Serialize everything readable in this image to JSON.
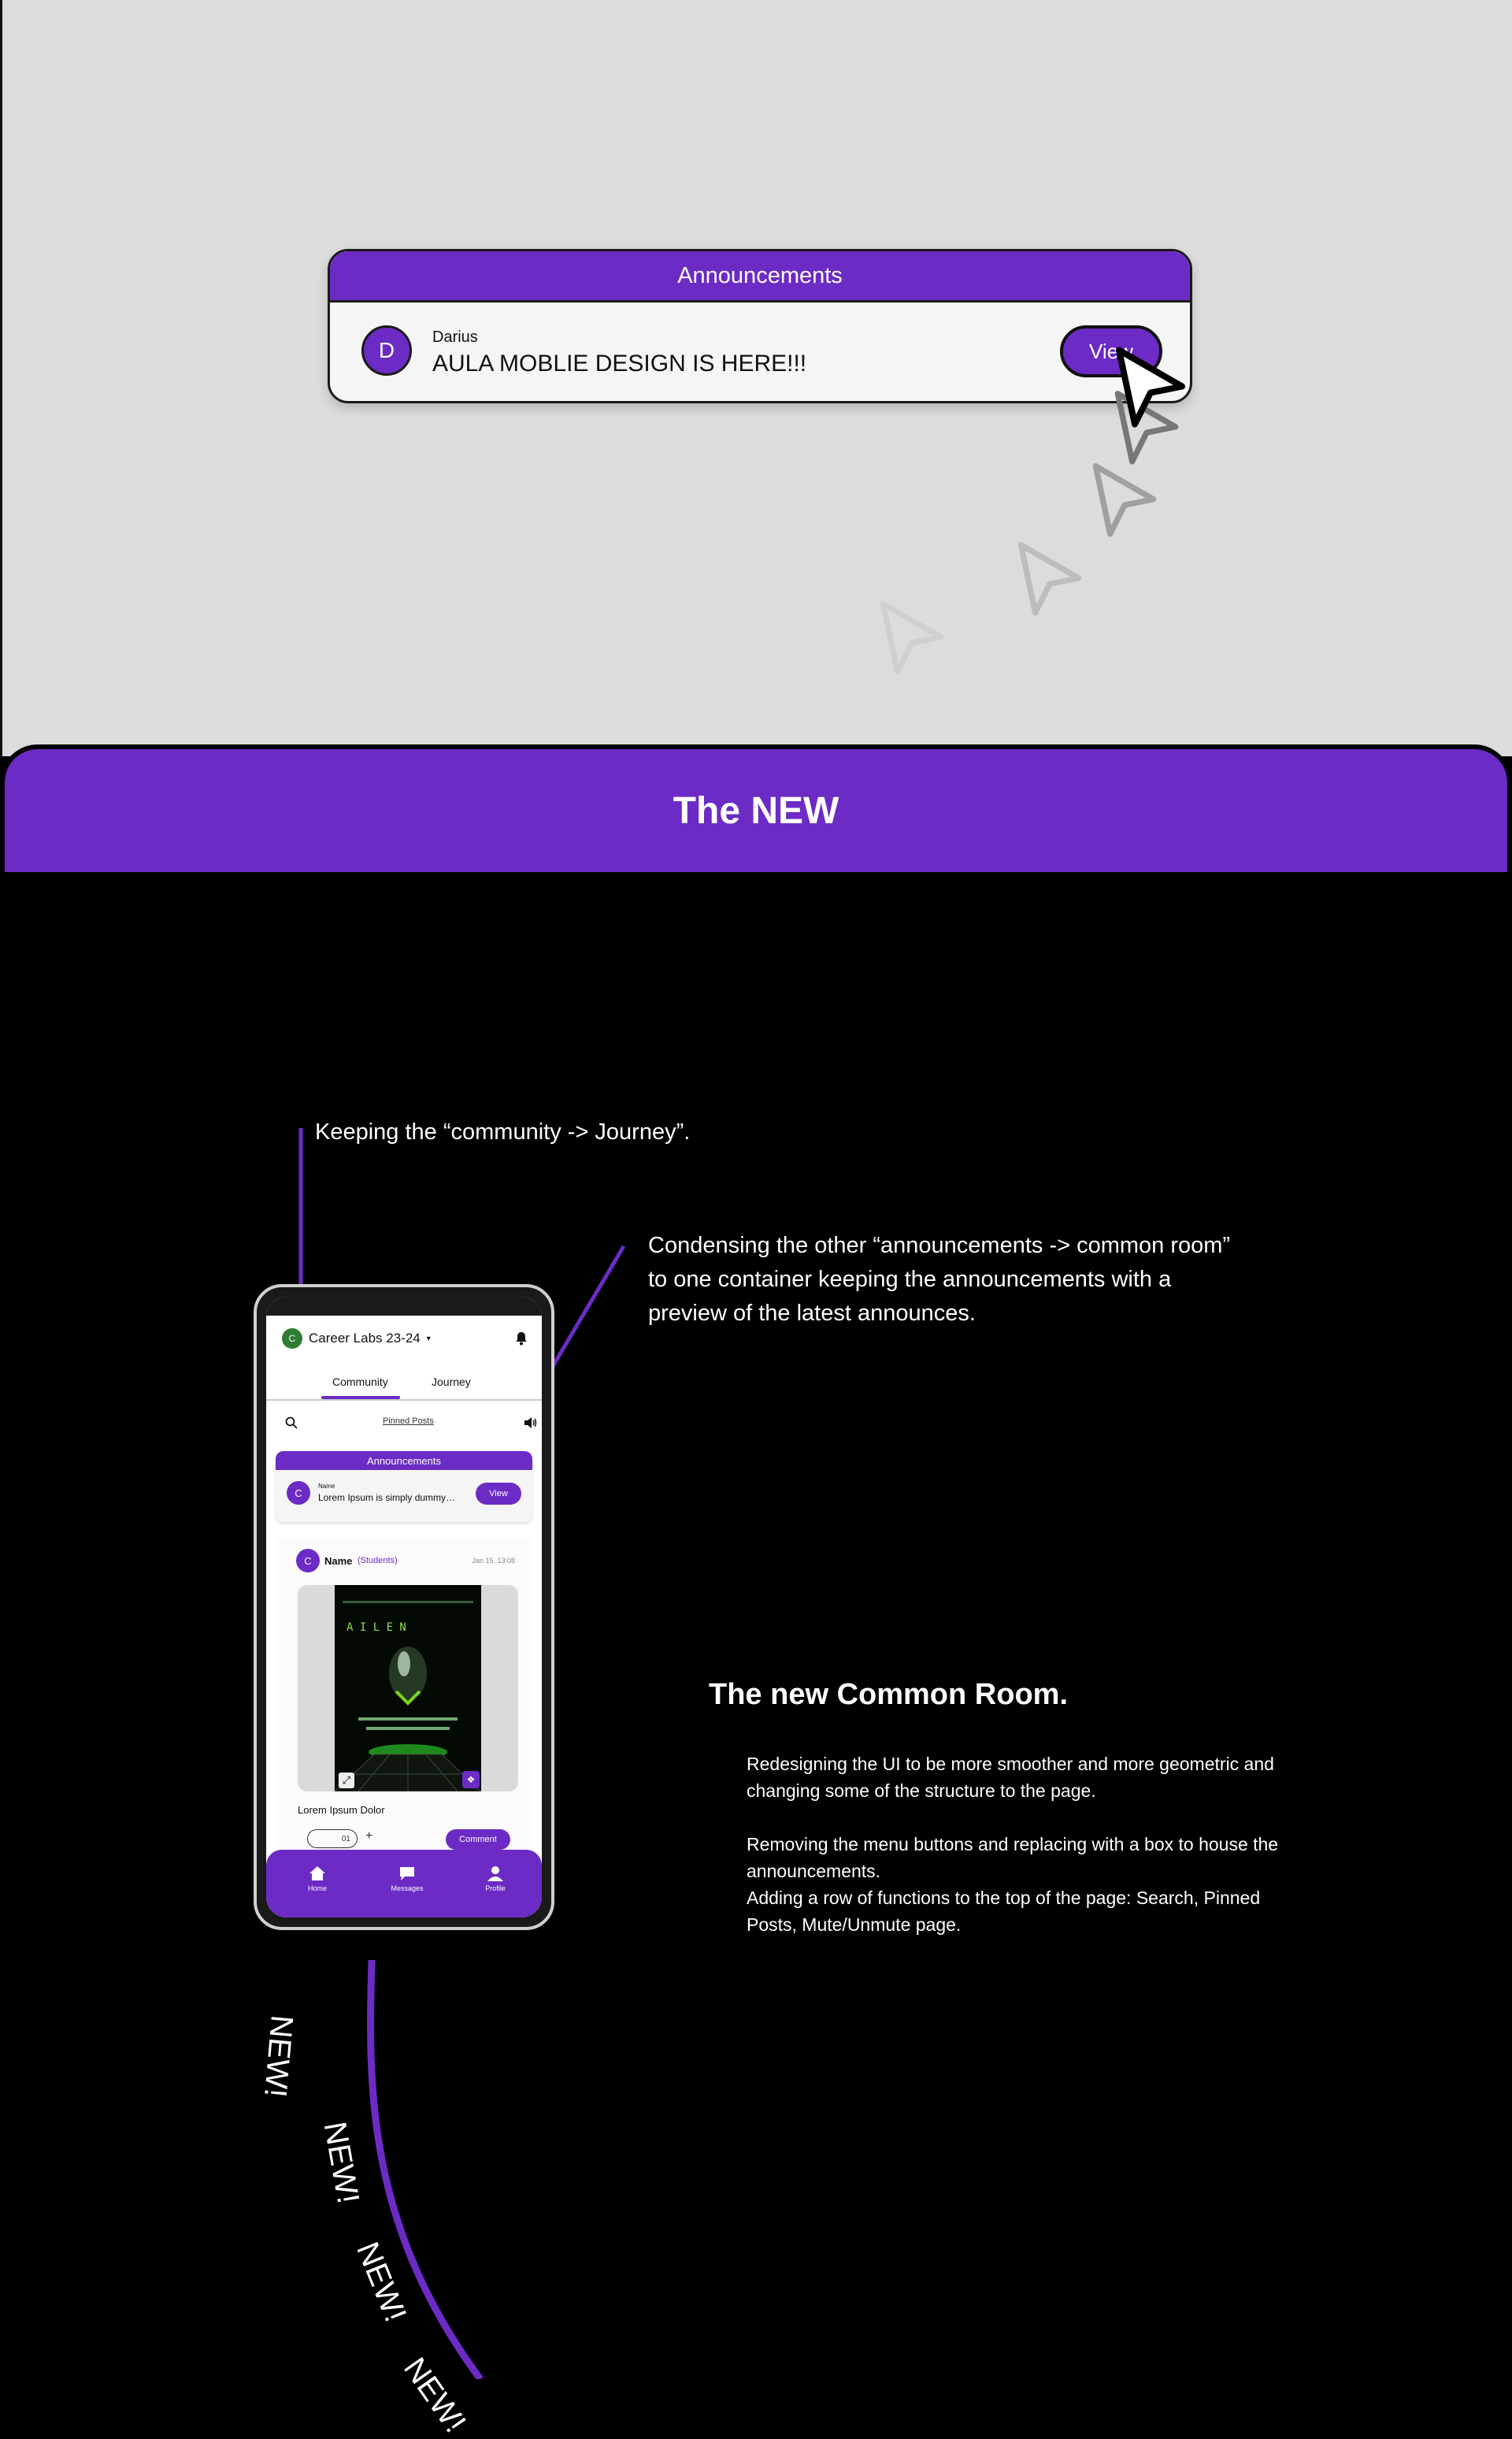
{
  "announcement_card": {
    "title": "Announcements",
    "avatar_letter": "D",
    "author": "Darius",
    "message": "AULA MOBLIE DESIGN IS HERE!!!",
    "view_label": "View"
  },
  "banner": {
    "title": "The NEW"
  },
  "notes": {
    "community": "Keeping the “community -> Journey”.",
    "condense": "Condensing the other “announcements -> common room” to one container keeping the announcements with a preview of the latest announces."
  },
  "section": {
    "heading": "The new Common Room.",
    "paragraph1": "Redesigning the UI to be more smoother and more geometric and changing some of the structure to the page.",
    "paragraph2": "Removing the menu buttons and replacing with a box to house the announcements.",
    "paragraph3": "Adding a row of functions to the top of the page: Search, Pinned Posts, Mute/Unmute page."
  },
  "phone": {
    "group_avatar": "C",
    "group_title": "Career Labs 23-24",
    "tabs": [
      "Community",
      "Journey"
    ],
    "pinned_label": "Pinned Posts",
    "announcement": {
      "title": "Announcements",
      "avatar_letter": "C",
      "name": "Name",
      "message": "Lorem Ipsum is simply dummy text",
      "view_label": "View"
    },
    "post": {
      "avatar_letter": "C",
      "name": "Name",
      "role": "(Students)",
      "date": "Jan 15, 13:08",
      "caption": "Lorem Ipsum Dolor",
      "likes": "01",
      "comment_label": "Comment"
    },
    "nav": [
      "Home",
      "Messages",
      "Profile"
    ]
  },
  "stamp": "NEW!",
  "colors": {
    "accent": "#6c2bc5",
    "background": "#000000",
    "top_background": "#dcdcdc"
  }
}
